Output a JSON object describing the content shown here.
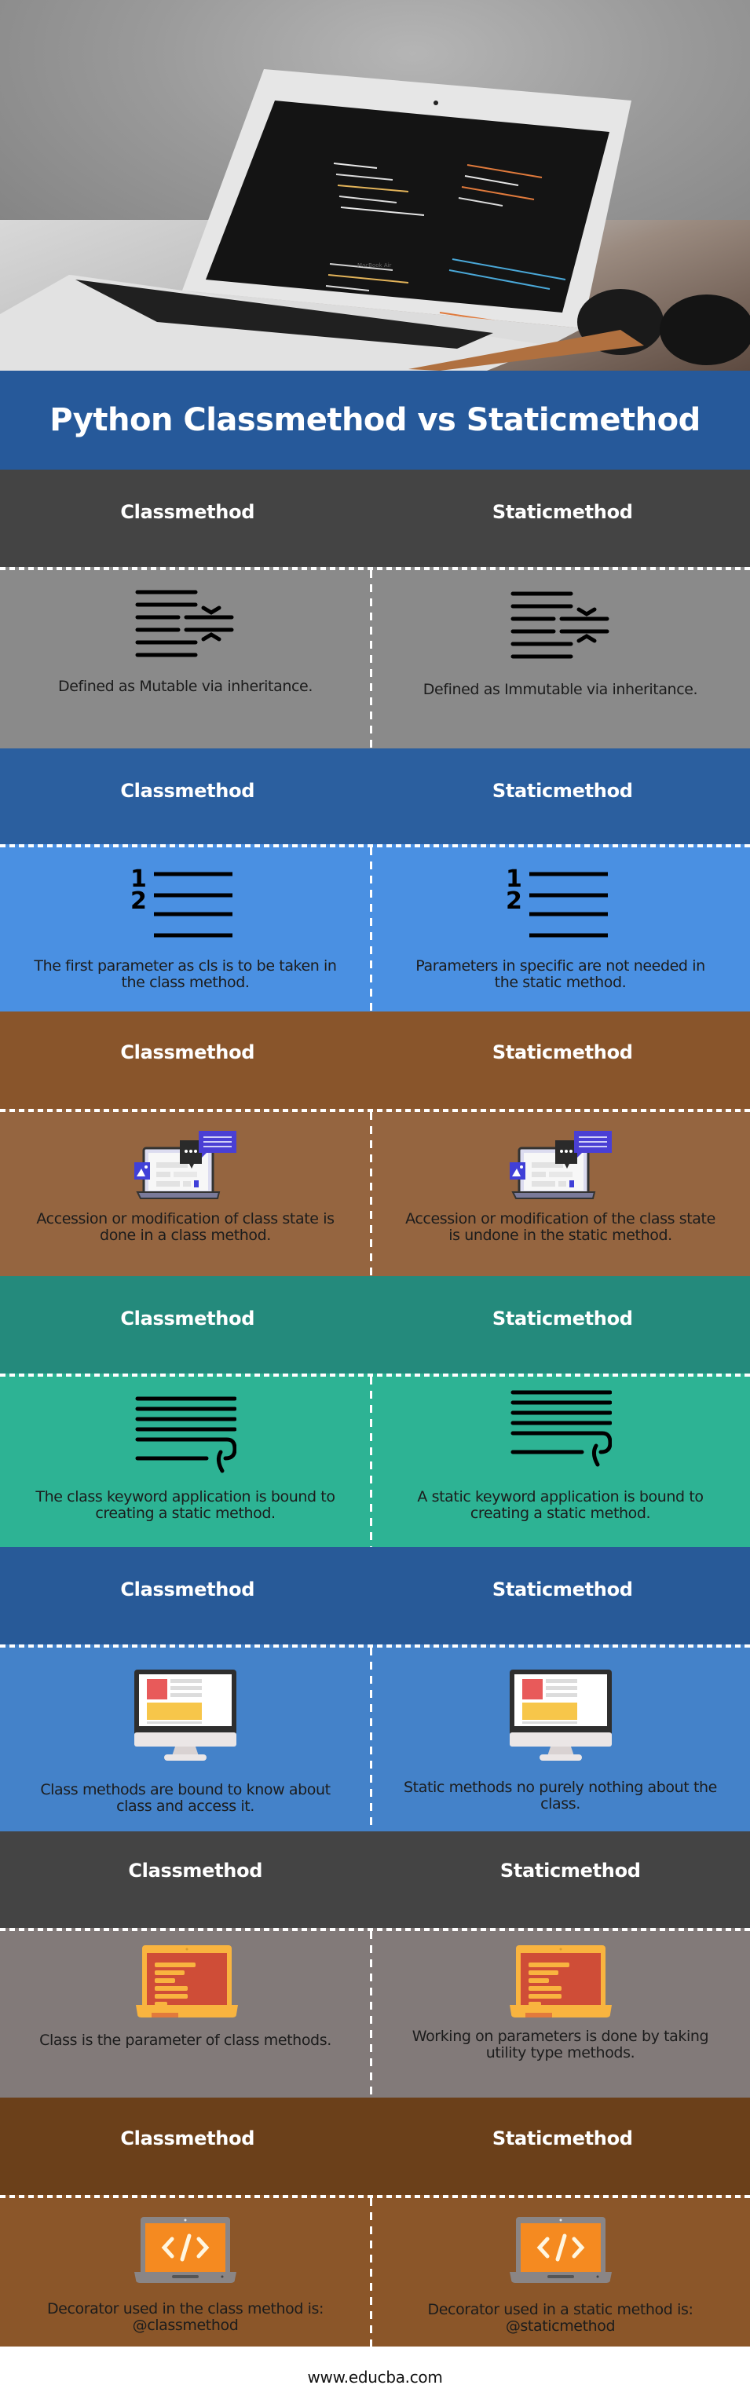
{
  "title": "Python Classmethod vs Staticmethod",
  "hero": {
    "image_description": "Laptop showing code editor on a desk with sunglasses and phone",
    "laptop_brand_text": "MacBook Air"
  },
  "colors": {
    "title_band": "#26599a",
    "sections": [
      {
        "head": "#444444",
        "body": "#8a8a8a"
      },
      {
        "head": "#2b5f9f",
        "body": "#4a90e2"
      },
      {
        "head": "#89552b",
        "body": "#956540"
      },
      {
        "head": "#248a7c",
        "body": "#2db394"
      },
      {
        "head": "#285a98",
        "body": "#4482c9"
      },
      {
        "head": "#444444",
        "body": "#827a79"
      },
      {
        "head": "#6b401a",
        "body": "#8b5629"
      }
    ]
  },
  "sections": [
    {
      "left_heading": "Classmethod",
      "right_heading": "Staticmethod",
      "icon": "text-collapse-icon",
      "left_text": "Defined as Mutable via inheritance.",
      "right_text": "Defined as Immutable via inheritance."
    },
    {
      "left_heading": "Classmethod",
      "right_heading": "Staticmethod",
      "icon": "numbered-list-icon",
      "left_text": "The first parameter as cls is to be taken in the class method.",
      "right_text": "Parameters in specific are not needed in the static method."
    },
    {
      "left_heading": "Classmethod",
      "right_heading": "Staticmethod",
      "icon": "laptop-chat-icon",
      "left_text": "Accession or modification of class state is done in a class method.",
      "right_text": "Accession or modification of the class state is undone in the static method."
    },
    {
      "left_heading": "Classmethod",
      "right_heading": "Staticmethod",
      "icon": "text-wrap-icon",
      "left_text": "The class keyword application is bound to creating a static method.",
      "right_text": "A static keyword application is bound to creating a static method."
    },
    {
      "left_heading": "Classmethod",
      "right_heading": "Staticmethod",
      "icon": "desktop-monitor-icon",
      "left_text": "Class methods are bound to know about class and access it.",
      "right_text": "Static methods no purely nothing about the class."
    },
    {
      "left_heading": "Classmethod",
      "right_heading": "Staticmethod",
      "icon": "laptop-document-icon",
      "left_text": "Class is the parameter of class methods.",
      "right_text": "Working on parameters is done by taking utility type methods."
    },
    {
      "left_heading": "Classmethod",
      "right_heading": "Staticmethod",
      "icon": "laptop-code-icon",
      "left_text": "Decorator used in the class method is: @classmethod",
      "right_text": "Decorator used in a static method is: @staticmethod"
    }
  ],
  "footer": {
    "site": "www.educba.com"
  }
}
